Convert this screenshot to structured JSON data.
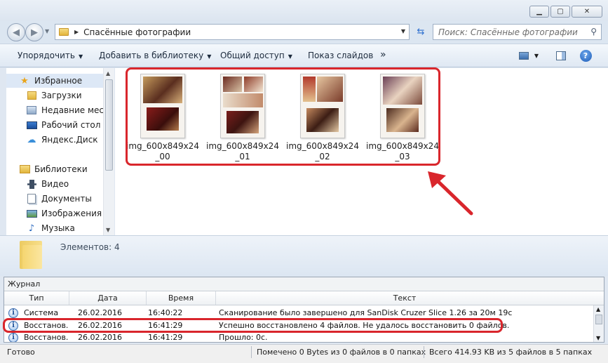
{
  "window": {
    "minimize_label": "▁",
    "maximize_label": "▢",
    "close_label": "✕"
  },
  "address": {
    "path": "Спасённые фотографии",
    "search_placeholder": "Поиск: Спасённые фотографии"
  },
  "toolbar": {
    "organize": "Упорядочить",
    "add_library": "Добавить в библиотеку",
    "share": "Общий доступ",
    "slideshow": "Показ слайдов",
    "more": "»"
  },
  "sidebar": {
    "items": [
      {
        "label": "Избранное",
        "icon": "star-icon"
      },
      {
        "label": "Загрузки",
        "icon": "downloads-icon"
      },
      {
        "label": "Недавние места",
        "icon": "recent-places-icon"
      },
      {
        "label": "Рабочий стол",
        "icon": "desktop-icon"
      },
      {
        "label": "Яндекс.Диск",
        "icon": "yandex-disk-icon"
      },
      {
        "label": "Библиотеки",
        "icon": "libraries-icon"
      },
      {
        "label": "Видео",
        "icon": "video-icon"
      },
      {
        "label": "Документы",
        "icon": "documents-icon"
      },
      {
        "label": "Изображения",
        "icon": "pictures-icon"
      },
      {
        "label": "Музыка",
        "icon": "music-icon"
      }
    ]
  },
  "files": [
    {
      "name": "img_600x849x24_00"
    },
    {
      "name": "img_600x849x24_01"
    },
    {
      "name": "img_600x849x24_02"
    },
    {
      "name": "img_600x849x24_03"
    }
  ],
  "details": {
    "count_text": "Элементов: 4"
  },
  "journal": {
    "title": "Журнал",
    "columns": [
      "Тип",
      "Дата",
      "Время",
      "Текст"
    ],
    "rows": [
      {
        "type": "Система",
        "date": "26.02.2016",
        "time": "16:40:22",
        "text": "Сканирование было завершено для SanDisk Cruzer Slice 1.26 за 20м 19с"
      },
      {
        "type": "Восстанов...",
        "date": "26.02.2016",
        "time": "16:41:29",
        "text": "Успешно восстановлено 4 файлов. Не удалось восстановить 0 файлов."
      },
      {
        "type": "Восстанов...",
        "date": "26.02.2016",
        "time": "16:41:29",
        "text": "Прошло: 0с."
      }
    ]
  },
  "status": {
    "ready": "Готово",
    "selected": "Помечено 0 Bytes из 0 файлов в 0 папках",
    "total": "Всего 414.93 KB из 5 файлов в 5 папках"
  },
  "colors": {
    "highlight": "#d9262c",
    "accent": "#2c6ecf"
  }
}
